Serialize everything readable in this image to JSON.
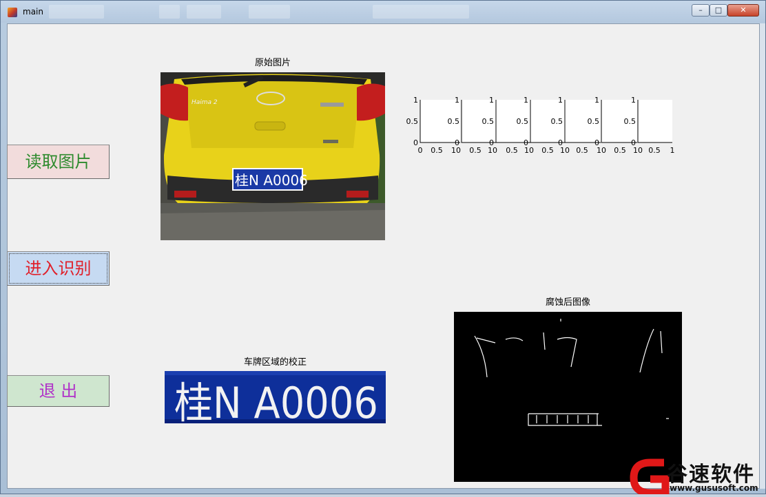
{
  "window": {
    "title": "main",
    "minimize_glyph": "–",
    "maximize_glyph": "□",
    "close_glyph": "✕"
  },
  "buttons": {
    "read_image": {
      "label": "读取图片",
      "bg": "#f2dcdc",
      "color": "#2e8b2e"
    },
    "recognize": {
      "label": "进入识别",
      "bg": "#c6daf2",
      "color": "#e0202a"
    },
    "exit": {
      "label": "退    出",
      "bg": "#cfe6cf",
      "color": "#b030c8"
    }
  },
  "panels": {
    "original": {
      "title": "原始图片",
      "plate_text": "桂N A0006",
      "logo_text": "Haima 2"
    },
    "corrected_plate": {
      "title": "车牌区域的校正",
      "plate_text": "桂N A0006"
    },
    "eroded": {
      "title": "腐蚀后图像"
    }
  },
  "char_axes": {
    "count": 7,
    "y_ticks": [
      "0",
      "0.5",
      "1"
    ],
    "x_tick_labels": [
      "0",
      "0.5",
      "10",
      "0.5",
      "10",
      "0.5",
      "10",
      "0.5",
      "10",
      "0.5",
      "10",
      "0.5",
      "10",
      "0.5",
      "1"
    ]
  },
  "watermark": {
    "brand": "谷速软件",
    "url": "www.gususoft.com"
  }
}
